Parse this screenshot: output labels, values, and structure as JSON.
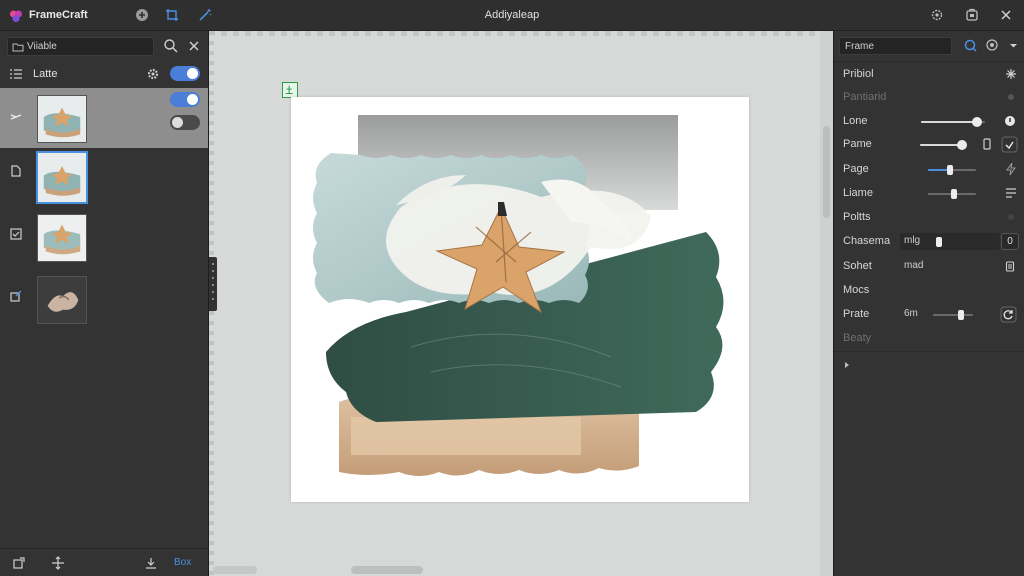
{
  "app": {
    "name": "FrameCraft"
  },
  "document": {
    "title": "Addiyaleap"
  },
  "colors": {
    "accent": "#4a90e2",
    "toggle_on": "#4a7ed8",
    "anchor": "#2e9e4c"
  },
  "left_panel": {
    "search": {
      "value": "Viiable"
    },
    "layer_header": {
      "label": "Latte"
    },
    "toggles": {
      "header": true,
      "row1_a": true,
      "row1_b": false
    },
    "bottom": {
      "text": "Box"
    }
  },
  "right_panel": {
    "name_field": {
      "value": "Frame"
    },
    "properties": [
      {
        "label": "Pribiol",
        "dim": false
      },
      {
        "label": "Pantiarid",
        "dim": true
      },
      {
        "label": "Lone",
        "dim": false
      },
      {
        "label": "Pame",
        "dim": false
      },
      {
        "label": "Page",
        "dim": false
      },
      {
        "label": "Liame",
        "dim": false
      },
      {
        "label": "Poltts",
        "dim": false
      },
      {
        "label": "Chasema",
        "dim": false,
        "value": "mlg",
        "number": "0"
      },
      {
        "label": "Sohet",
        "dim": false,
        "value": "mad"
      },
      {
        "label": "Mocs",
        "dim": false
      },
      {
        "label": "Prate",
        "dim": false,
        "value": "6m"
      },
      {
        "label": "Beaty",
        "dim": true
      }
    ],
    "sliders": {
      "lone": 0.88,
      "pame": 0.92,
      "page": 0.45,
      "liame": 0.55,
      "chasema": 0.05,
      "prate": 0.7
    }
  }
}
